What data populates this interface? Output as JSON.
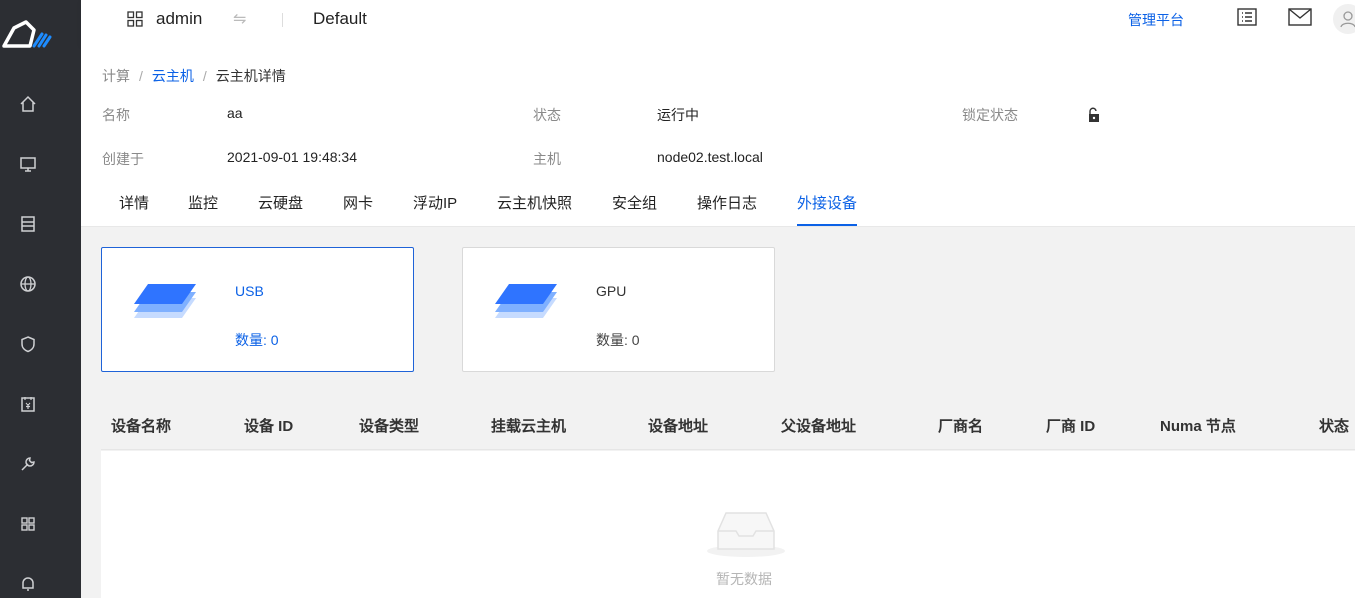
{
  "topbar": {
    "project": "admin",
    "swap_icon": "⇋",
    "domain": "Default",
    "admin_link": "管理平台"
  },
  "sidebar": {
    "items": [
      "home-icon",
      "monitor-icon",
      "storage-icon",
      "globe-icon",
      "shield-icon",
      "billing-icon",
      "wrench-icon",
      "apps-icon",
      "bell-icon"
    ]
  },
  "breadcrumb": {
    "root": "计算",
    "parent": "云主机",
    "current": "云主机详情",
    "separator": "/"
  },
  "info": {
    "name_label": "名称",
    "name_value": "aa",
    "status_label": "状态",
    "status_value": "运行中",
    "lock_label": "锁定状态",
    "created_label": "创建于",
    "created_value": "2021-09-01 19:48:34",
    "host_label": "主机",
    "host_value": "node02.test.local"
  },
  "tabs": [
    "详情",
    "监控",
    "云硬盘",
    "网卡",
    "浮动IP",
    "云主机快照",
    "安全组",
    "操作日志",
    "外接设备"
  ],
  "active_tab": "外接设备",
  "cards": [
    {
      "title": "USB",
      "count": "数量: 0",
      "active": true
    },
    {
      "title": "GPU",
      "count": "数量: 0",
      "active": false
    }
  ],
  "table": {
    "columns": [
      "设备名称",
      "设备 ID",
      "设备类型",
      "挂载云主机",
      "设备地址",
      "父设备地址",
      "厂商名",
      "厂商 ID",
      "Numa 节点",
      "状态"
    ],
    "empty_text": "暂无数据"
  },
  "colors": {
    "accent": "#0b61e6",
    "sidebar_bg": "#2c2e33"
  }
}
